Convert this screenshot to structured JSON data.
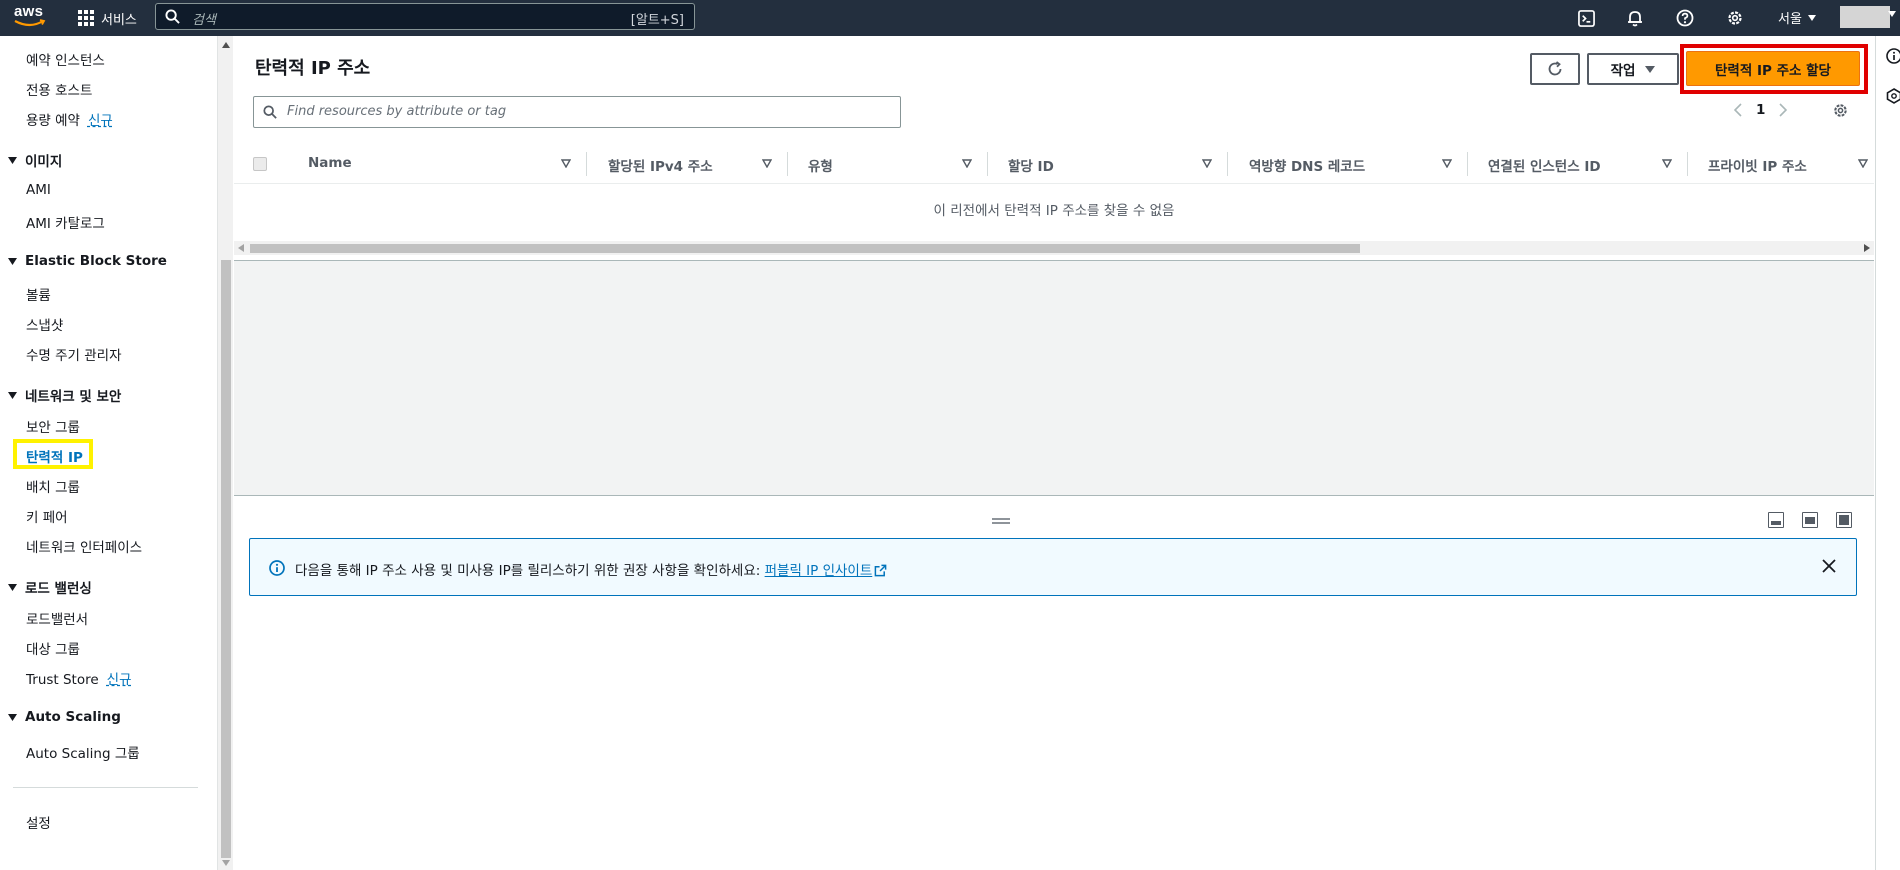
{
  "topnav": {
    "logo_text": "aws",
    "services_label": "서비스",
    "search_placeholder": "검색",
    "search_shortcut": "[알트+S]",
    "region_label": "서울",
    "icons": [
      "cloudshell-icon",
      "notifications-icon",
      "help-icon",
      "settings-icon"
    ]
  },
  "sidebar": {
    "items_top": [
      {
        "label": "예약 인스턴스"
      },
      {
        "label": "전용 호스트"
      },
      {
        "label": "용량 예약",
        "badge": "신규"
      }
    ],
    "sections": [
      {
        "title": "이미지",
        "items": [
          {
            "label": "AMI"
          },
          {
            "label": "AMI 카탈로그"
          }
        ]
      },
      {
        "title": "Elastic Block Store",
        "items": [
          {
            "label": "볼륨"
          },
          {
            "label": "스냅샷"
          },
          {
            "label": "수명 주기 관리자"
          }
        ]
      },
      {
        "title": "네트워크 및 보안",
        "items": [
          {
            "label": "보안 그룹"
          },
          {
            "label": "탄력적 IP"
          },
          {
            "label": "배치 그룹"
          },
          {
            "label": "키 페어"
          },
          {
            "label": "네트워크 인터페이스"
          }
        ]
      },
      {
        "title": "로드 밸런싱",
        "items": [
          {
            "label": "로드밸런서"
          },
          {
            "label": "대상 그룹"
          },
          {
            "label": "Trust Store",
            "badge": "신규"
          }
        ]
      },
      {
        "title": "Auto Scaling",
        "items": [
          {
            "label": "Auto Scaling 그룹"
          }
        ]
      }
    ],
    "settings_label": "설정",
    "active_item": "탄력적 IP"
  },
  "main": {
    "title": "탄력적 IP 주소",
    "actions_label": "작업",
    "allocate_label": "탄력적 IP 주소 할당",
    "filter_placeholder": "Find resources by attribute or tag",
    "current_page": "1",
    "columns": [
      "Name",
      "할당된 IPv4 주소",
      "유형",
      "할당 ID",
      "역방향 DNS 레코드",
      "연결된 인스턴스 ID",
      "프라이빗 IP 주소"
    ],
    "empty_message": "이 리전에서 탄력적 IP 주소를 찾을 수 없음",
    "info_text": "다음을 통해 IP 주소 사용 및 미사용 IP를 릴리스하기 위한 권장 사항을 확인하세요: ",
    "info_link": "퍼블릭 IP 인사이트"
  },
  "colors": {
    "topnav_bg": "#232f3e",
    "primary_button": "#ff9900",
    "link": "#0073bb",
    "highlight_red": "#e00000",
    "highlight_yellow": "#fff200",
    "info_bg": "#f1faff"
  }
}
